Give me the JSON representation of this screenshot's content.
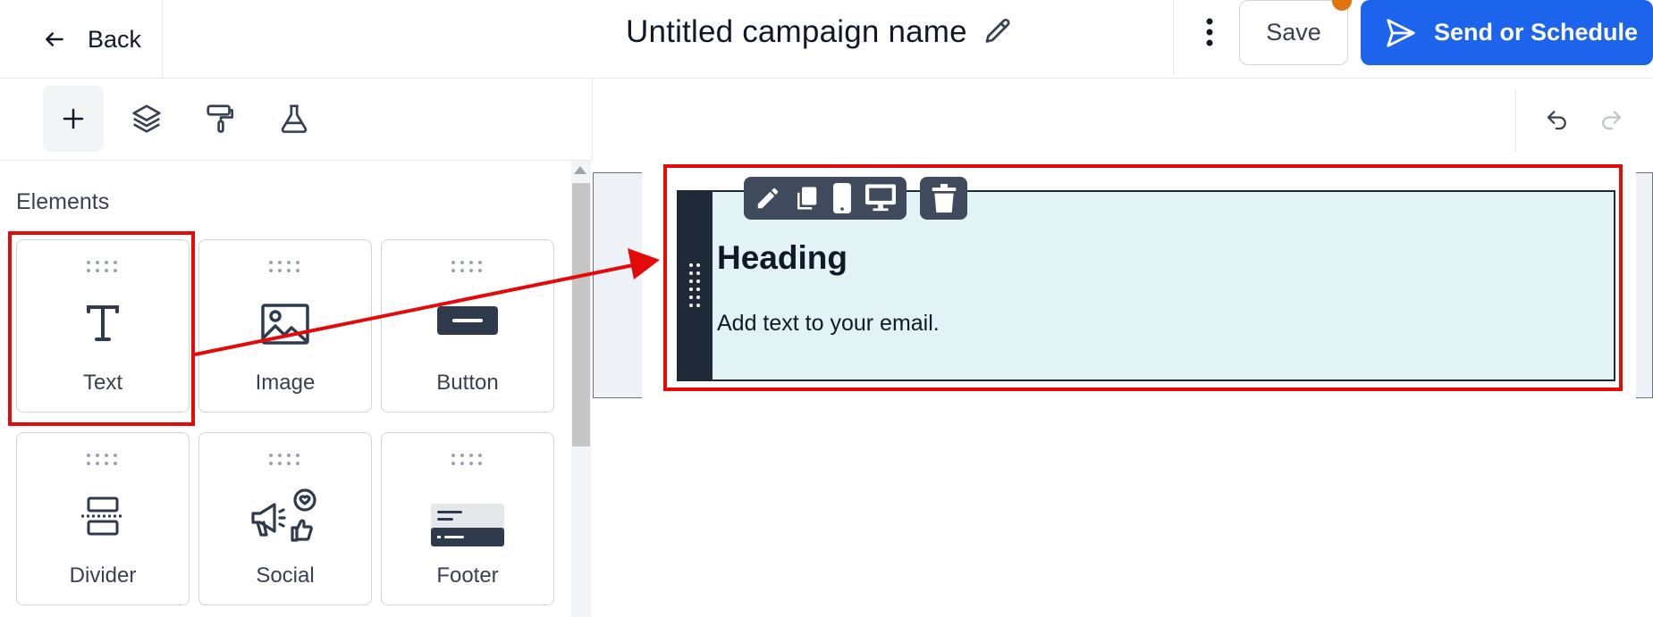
{
  "header": {
    "back_label": "Back",
    "campaign_title": "Untitled campaign name",
    "save_label": "Save",
    "send_label": "Send or Schedule"
  },
  "toolbar": {
    "tools": [
      "plus-icon",
      "layers-icon",
      "paint-roller-icon",
      "flask-icon"
    ],
    "undo": "undo-icon",
    "redo": "redo-icon"
  },
  "elements_panel": {
    "title": "Elements",
    "items": [
      {
        "label": "Text",
        "icon": "text-icon"
      },
      {
        "label": "Image",
        "icon": "image-icon"
      },
      {
        "label": "Button",
        "icon": "button-icon"
      },
      {
        "label": "Divider",
        "icon": "divider-icon"
      },
      {
        "label": "Social",
        "icon": "social-icon"
      },
      {
        "label": "Footer",
        "icon": "footer-icon"
      }
    ]
  },
  "canvas": {
    "heading": "Heading",
    "paragraph": "Add text to your email.",
    "block_tools": [
      "edit-icon",
      "duplicate-icon",
      "mobile-icon",
      "desktop-icon",
      "delete-icon"
    ]
  },
  "colors": {
    "primary": "#1d64ec",
    "notification_dot": "#e0740e",
    "annotation_red": "#e40a0a",
    "block_bg": "#e2f3f6",
    "block_handle": "#1f2937"
  }
}
